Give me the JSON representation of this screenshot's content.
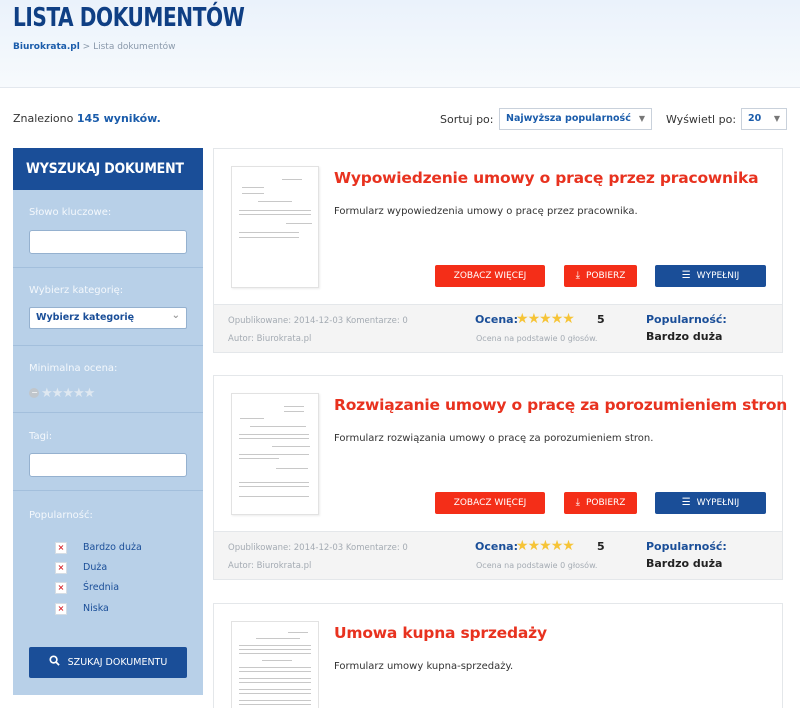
{
  "header": {
    "title": "LISTA DOKUMENTÓW",
    "breadcrumb": {
      "home": "Biurokrata.pl",
      "separator": ">",
      "current": "Lista dokumentów"
    }
  },
  "results": {
    "found_prefix": "Znaleziono",
    "found_count": "145 wyników.",
    "sort_label": "Sortuj po:",
    "sort_value": "Najwyższa popularność",
    "show_label": "Wyświetl po:",
    "show_value": "20"
  },
  "sidebar": {
    "title": "WYSZUKAJ DOKUMENT",
    "keyword_label": "Słowo kluczowe:",
    "keyword_value": "",
    "category_label": "Wybierz kategorię:",
    "category_value": "Wybierz kategorię",
    "min_rating_label": "Minimalna ocena:",
    "min_rating_value": 0,
    "tags_label": "Tagi:",
    "tags_value": "",
    "popularity_label": "Popularność:",
    "popularity_options": [
      {
        "label": "Bardzo duża"
      },
      {
        "label": "Duża"
      },
      {
        "label": "Średnia"
      },
      {
        "label": "Niska"
      }
    ],
    "search_button": "SZUKAJ DOKUMENTU"
  },
  "documents": [
    {
      "title": "Wypowiedzenie umowy o pracę przez pracownika",
      "description": "Formularz wypowiedzenia umowy o pracę przez pracownika.",
      "more_button": "ZOBACZ WIĘCEJ",
      "download_button": "POBIERZ",
      "fill_button": "WYPEŁNIJ",
      "published": "Opublikowane: 2014-12-03 Komentarze: 0",
      "author": "Autor: Biurokrata.pl",
      "rating_label": "Ocena:",
      "rating_value": "5",
      "rating_basis": "Ocena na podstawie 0 głosów.",
      "popularity_label": "Popularność:",
      "popularity_value": "Bardzo duża"
    },
    {
      "title": "Rozwiązanie umowy o pracę za porozumieniem stron",
      "description": "Formularz rozwiązania umowy o pracę za porozumieniem stron.",
      "more_button": "ZOBACZ WIĘCEJ",
      "download_button": "POBIERZ",
      "fill_button": "WYPEŁNIJ",
      "published": "Opublikowane: 2014-12-03 Komentarze: 0",
      "author": "Autor: Biurokrata.pl",
      "rating_label": "Ocena:",
      "rating_value": "5",
      "rating_basis": "Ocena na podstawie 0 głosów.",
      "popularity_label": "Popularność:",
      "popularity_value": "Bardzo duża"
    },
    {
      "title": "Umowa kupna sprzedaży",
      "description": "Formularz umowy kupna-sprzedaży."
    }
  ],
  "colors": {
    "brand_blue": "#1a4e98",
    "accent_red": "#f42e18",
    "title_red": "#e8321f",
    "star_gold": "#f6c437",
    "sidebar_bg": "#b8d0e8"
  }
}
